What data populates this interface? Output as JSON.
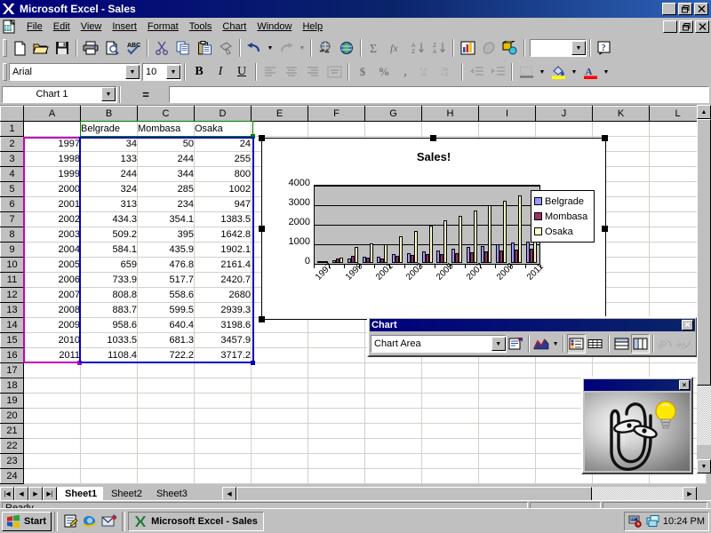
{
  "window": {
    "title": "Microsoft Excel - Sales",
    "app_buttons": [
      "minimize",
      "restore",
      "close"
    ],
    "doc_buttons": [
      "minimize",
      "restore",
      "close"
    ]
  },
  "menu": {
    "items": [
      {
        "label": "File",
        "accel": "F"
      },
      {
        "label": "Edit",
        "accel": "E"
      },
      {
        "label": "View",
        "accel": "V"
      },
      {
        "label": "Insert",
        "accel": "I"
      },
      {
        "label": "Format",
        "accel": "o"
      },
      {
        "label": "Tools",
        "accel": "T"
      },
      {
        "label": "Chart",
        "accel": "C"
      },
      {
        "label": "Window",
        "accel": "W"
      },
      {
        "label": "Help",
        "accel": "H"
      }
    ]
  },
  "standard_toolbar": {
    "buttons": [
      "new-icon",
      "open-icon",
      "save-icon",
      "print-icon",
      "print-preview-icon",
      "spelling-icon",
      "cut-icon",
      "copy-icon",
      "paste-icon",
      "format-painter-icon",
      "undo-icon",
      "undo-dropdown-icon",
      "redo-icon",
      "redo-dropdown-icon",
      "hyperlink-icon",
      "web-toolbar-icon",
      "autosum-icon",
      "paste-function-icon",
      "sort-ascending-icon",
      "sort-descending-icon",
      "chart-wizard-icon",
      "map-icon",
      "drawing-icon"
    ],
    "zoom_value": "",
    "help_icon": "help-icon"
  },
  "formatting_toolbar": {
    "font_name": "Arial",
    "font_size": "10",
    "buttons": [
      "bold-icon",
      "italic-icon",
      "underline-icon",
      "align-left-icon",
      "align-center-icon",
      "align-right-icon",
      "merge-center-icon",
      "currency-icon",
      "percent-icon",
      "comma-icon",
      "increase-decimal-icon",
      "decrease-decimal-icon",
      "decrease-indent-icon",
      "increase-indent-icon",
      "borders-icon",
      "fill-color-icon",
      "font-color-icon"
    ]
  },
  "formula_bar": {
    "name_box": "Chart 1",
    "equals_label": "=",
    "formula": ""
  },
  "sheet": {
    "columns": [
      "A",
      "B",
      "C",
      "D",
      "E",
      "F",
      "G",
      "H",
      "I",
      "J",
      "K",
      "L"
    ],
    "rows": [
      1,
      2,
      3,
      4,
      5,
      6,
      7,
      8,
      9,
      10,
      11,
      12,
      13,
      14,
      15,
      16,
      17,
      18,
      19,
      20,
      21,
      22,
      23,
      24
    ],
    "header_row": {
      "A": "",
      "B": "Belgrade",
      "C": "Mombasa",
      "D": "Osaka"
    },
    "data": [
      {
        "A": "1997",
        "B": "34",
        "C": "50",
        "D": "24"
      },
      {
        "A": "1998",
        "B": "133",
        "C": "244",
        "D": "255"
      },
      {
        "A": "1999",
        "B": "244",
        "C": "344",
        "D": "800"
      },
      {
        "A": "2000",
        "B": "324",
        "C": "285",
        "D": "1002"
      },
      {
        "A": "2001",
        "B": "313",
        "C": "234",
        "D": "947"
      },
      {
        "A": "2002",
        "B": "434.3",
        "C": "354.1",
        "D": "1383.5"
      },
      {
        "A": "2003",
        "B": "509.2",
        "C": "395",
        "D": "1642.8"
      },
      {
        "A": "2004",
        "B": "584.1",
        "C": "435.9",
        "D": "1902.1"
      },
      {
        "A": "2005",
        "B": "659",
        "C": "476.8",
        "D": "2161.4"
      },
      {
        "A": "2006",
        "B": "733.9",
        "C": "517.7",
        "D": "2420.7"
      },
      {
        "A": "2007",
        "B": "808.8",
        "C": "558.6",
        "D": "2680"
      },
      {
        "A": "2008",
        "B": "883.7",
        "C": "599.5",
        "D": "2939.3"
      },
      {
        "A": "2009",
        "B": "958.6",
        "C": "640.4",
        "D": "3198.6"
      },
      {
        "A": "2010",
        "B": "1033.5",
        "C": "681.3",
        "D": "3457.9"
      },
      {
        "A": "2011",
        "B": "1108.4",
        "C": "722.2",
        "D": "3717.2"
      }
    ]
  },
  "chart_data": {
    "type": "bar",
    "title": "Sales!",
    "xlabel": "",
    "ylabel": "",
    "ylim": [
      0,
      4000
    ],
    "yticks": [
      "0",
      "1000",
      "2000",
      "3000",
      "4000"
    ],
    "grid": true,
    "legend_position": "right",
    "categories": [
      "1997",
      "1998",
      "1999",
      "2000",
      "2001",
      "2002",
      "2003",
      "2004",
      "2005",
      "2006",
      "2007",
      "2008",
      "2009",
      "2010",
      "2011"
    ],
    "tick_labels_shown": [
      "1997",
      "1999",
      "2001",
      "2003",
      "2005",
      "2007",
      "2009",
      "2011"
    ],
    "series": [
      {
        "name": "Belgrade",
        "color": "#9999ff",
        "values": [
          34,
          133,
          244,
          324,
          313,
          434.3,
          509.2,
          584.1,
          659,
          733.9,
          808.8,
          883.7,
          958.6,
          1033.5,
          1108.4
        ]
      },
      {
        "name": "Mombasa",
        "color": "#993366",
        "values": [
          50,
          244,
          344,
          285,
          234,
          354.1,
          395,
          435.9,
          476.8,
          517.7,
          558.6,
          599.5,
          640.4,
          681.3,
          722.2
        ]
      },
      {
        "name": "Osaka",
        "color": "#ffffcc",
        "values": [
          24,
          255,
          800,
          1002,
          947,
          1383.5,
          1642.8,
          1902.1,
          2161.4,
          2420.7,
          2680,
          2939.3,
          3198.6,
          3457.9,
          3717.2
        ]
      }
    ]
  },
  "chart_toolbar": {
    "title": "Chart",
    "close_label": "×",
    "selected_object": "Chart Area",
    "buttons": [
      "format-object-icon",
      "chart-type-icon",
      "chart-type-dropdown-icon",
      "legend-icon",
      "data-table-icon",
      "by-row-icon",
      "by-column-icon",
      "angle-text-down-icon",
      "angle-text-up-icon"
    ]
  },
  "assistant": {
    "name": "office-assistant-clippy",
    "close_label": "×",
    "has_lightbulb": true
  },
  "sheet_tabs": {
    "tabs": [
      "Sheet1",
      "Sheet2",
      "Sheet3"
    ],
    "active": "Sheet1",
    "nav_buttons": [
      "first-sheet",
      "prev-sheet",
      "next-sheet",
      "last-sheet"
    ]
  },
  "status_bar": {
    "message": "Ready",
    "mode_box": "",
    "num_box": ""
  },
  "taskbar": {
    "start_label": "Start",
    "quick_launch": [
      "show-desktop-icon",
      "internet-explorer-icon",
      "outlook-express-icon"
    ],
    "tasks": [
      {
        "label": "Microsoft Excel - Sales",
        "icon": "excel-icon",
        "active": true
      }
    ],
    "tray_icons": [
      "modem-icon",
      "network-icon"
    ],
    "clock": "10:24 PM"
  },
  "colors": {
    "titlebar_start": "#00007b",
    "titlebar_end": "#2f63b8",
    "face": "#c0c0c0",
    "selection_green": "#008000",
    "selection_blue": "#0000c0",
    "selection_magenta": "#c000c0"
  }
}
